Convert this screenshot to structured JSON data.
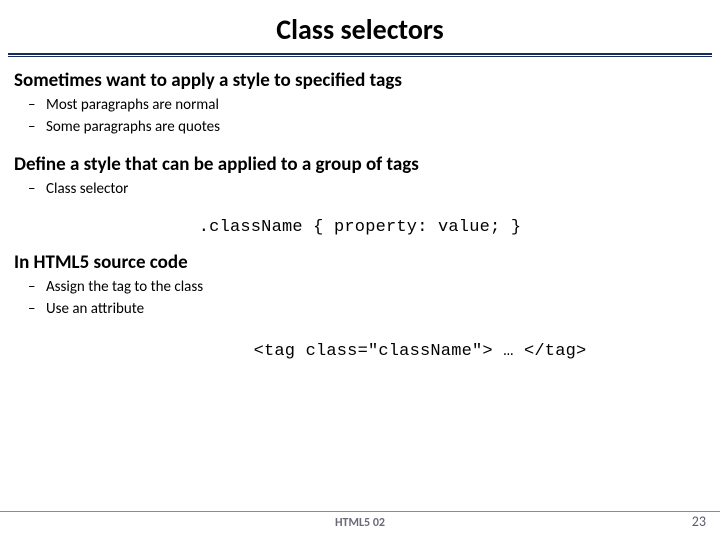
{
  "title": "Class selectors",
  "section1": {
    "heading": "Sometimes want to apply a style to specified tags",
    "bullets": [
      "Most paragraphs are normal",
      "Some paragraphs are quotes"
    ]
  },
  "section2": {
    "heading": "Define a style that can be applied to a group of tags",
    "bullets": [
      "Class selector"
    ],
    "code": ".className { property: value; }"
  },
  "section3": {
    "heading": "In HTML5 source code",
    "bullets": [
      "Assign the tag to the class",
      "Use an attribute"
    ],
    "code": "<tag class=\"className\"> … </tag>"
  },
  "footer": {
    "label": "HTML5 02",
    "page": "23"
  }
}
